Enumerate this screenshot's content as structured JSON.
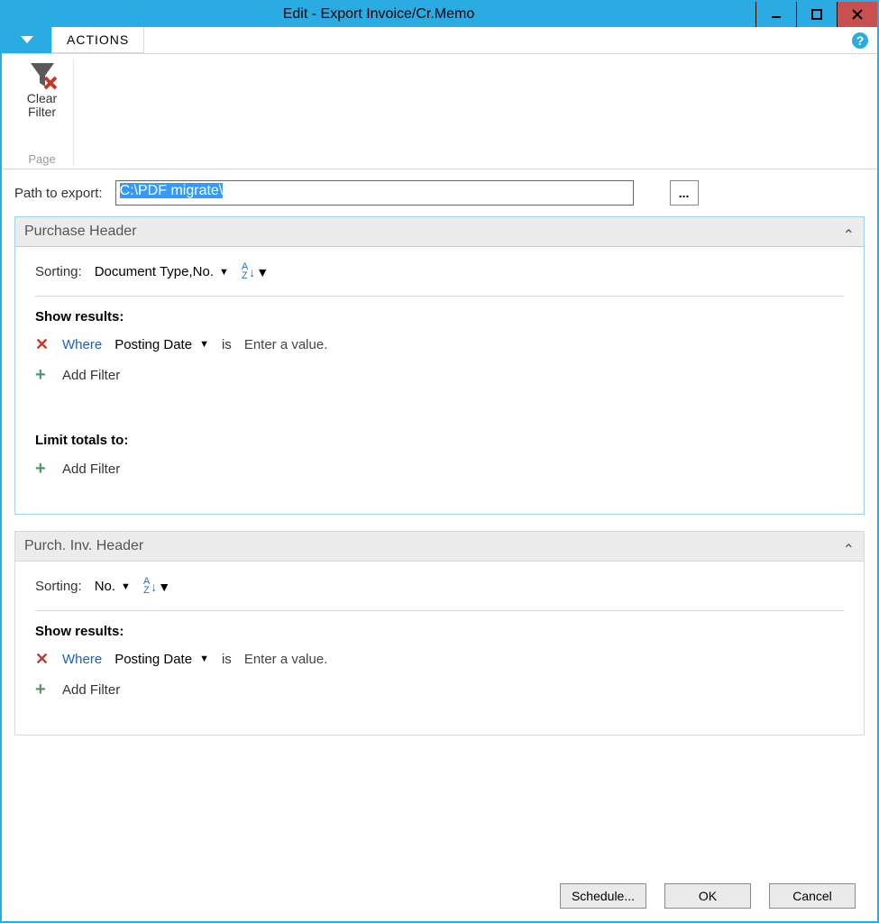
{
  "window": {
    "title": "Edit - Export Invoice/Cr.Memo"
  },
  "ribbon": {
    "actions_tab": "ACTIONS",
    "clear_filter": "Clear\nFilter",
    "page_group": "Page"
  },
  "path": {
    "label": "Path to export:",
    "value": "C:\\PDF migrate\\",
    "browse": "..."
  },
  "sections": [
    {
      "title": "Purchase Header",
      "sorting_label": "Sorting:",
      "sorting_value": "Document Type,No.",
      "show_results": "Show results:",
      "where": "Where",
      "filter_field": "Posting Date",
      "is": "is",
      "enter_value": "Enter a value.",
      "add_filter": "Add Filter",
      "limit_totals": "Limit totals to:",
      "add_filter2": "Add Filter"
    },
    {
      "title": "Purch. Inv. Header",
      "sorting_label": "Sorting:",
      "sorting_value": "No.",
      "show_results": "Show results:",
      "where": "Where",
      "filter_field": "Posting Date",
      "is": "is",
      "enter_value": "Enter a value.",
      "add_filter": "Add Filter"
    }
  ],
  "footer": {
    "schedule": "Schedule...",
    "ok": "OK",
    "cancel": "Cancel"
  }
}
